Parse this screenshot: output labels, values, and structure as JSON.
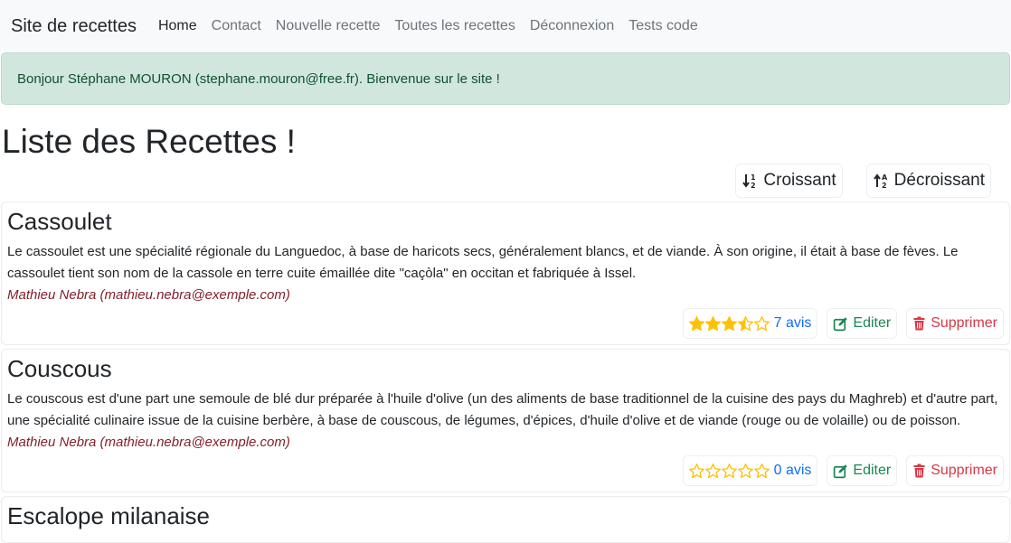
{
  "nav": {
    "brand": "Site de recettes",
    "links": [
      "Home",
      "Contact",
      "Nouvelle recette",
      "Toutes les recettes",
      "Déconnexion",
      "Tests code"
    ]
  },
  "alert": {
    "message": "Bonjour Stéphane MOURON (stephane.mouron@free.fr). Bienvenue sur le site !"
  },
  "page": {
    "title": "Liste des Recettes !"
  },
  "sort": {
    "asc_label": "Croissant",
    "desc_label": "Décroissant"
  },
  "colors": {
    "star": "#ffc107",
    "link": "#0d6efd",
    "edit": "#198754",
    "delete": "#dc3545",
    "author": "#842029"
  },
  "recipes": [
    {
      "title": "Cassoulet",
      "description": "Le cassoulet est une spécialité régionale du Languedoc, à base de haricots secs, généralement blancs, et de viande. À son origine, il était à base de fèves. Le cassoulet tient son nom de la cassole en terre cuite émaillée dite \"caçòla\" en occitan et fabriquée à Issel.",
      "author": "Mathieu Nebra (mathieu.nebra@exemple.com)",
      "rating": 3.5,
      "reviews_label": "7 avis",
      "edit_label": "Editer",
      "delete_label": "Supprimer"
    },
    {
      "title": "Couscous",
      "description": "Le couscous est d'une part une semoule de blé dur préparée à l'huile d'olive (un des aliments de base traditionnel de la cuisine des pays du Maghreb) et d'autre part, une spécialité culinaire issue de la cuisine berbère, à base de couscous, de légumes, d'épices, d'huile d'olive et de viande (rouge ou de volaille) ou de poisson.",
      "author": "Mathieu Nebra (mathieu.nebra@exemple.com)",
      "rating": 0,
      "reviews_label": "0 avis",
      "edit_label": "Editer",
      "delete_label": "Supprimer"
    },
    {
      "title": "Escalope milanaise"
    }
  ]
}
